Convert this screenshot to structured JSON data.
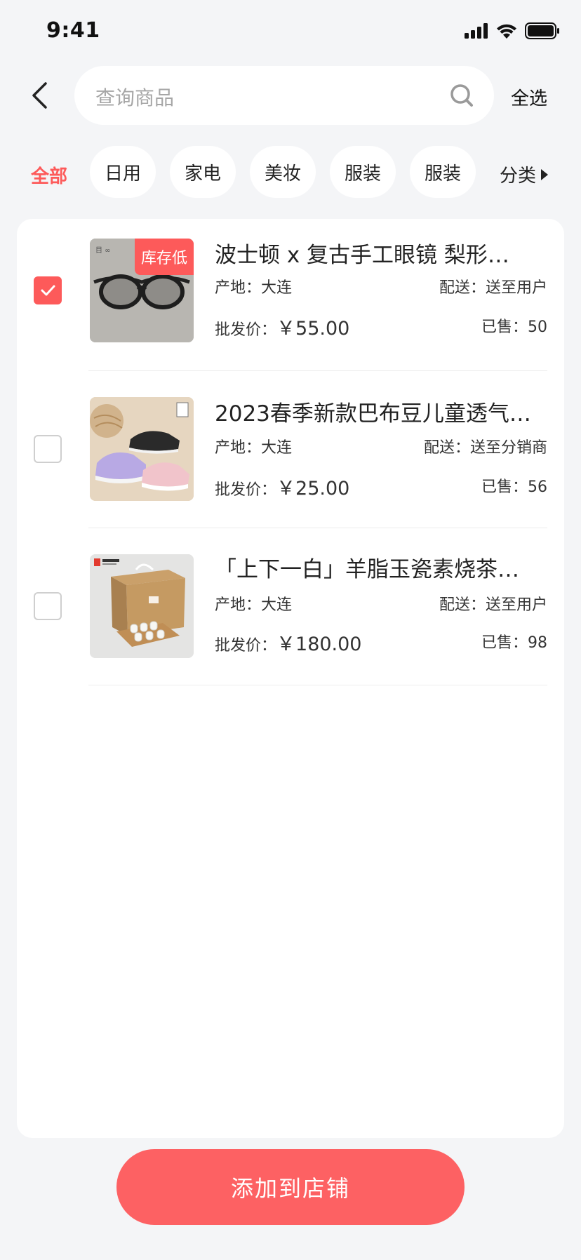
{
  "status_bar": {
    "time": "9:41"
  },
  "header": {
    "search_placeholder": "查询商品",
    "select_all": "全选"
  },
  "categories": {
    "active": "全部",
    "pills": [
      "日用",
      "家电",
      "美妆",
      "服装",
      "服装"
    ],
    "more": "分类"
  },
  "products": [
    {
      "checked": true,
      "badge": "库存低",
      "title": "波士顿 x 复古手工眼镜 梨形…",
      "origin": "产地：大连",
      "shipping": "配送：送至用户",
      "price_label": "批发价：",
      "price": "￥55.00",
      "sold": "已售：50",
      "image": "glasses"
    },
    {
      "checked": false,
      "badge": "",
      "title": "2023春季新款巴布豆儿童透气…",
      "origin": "产地：大连",
      "shipping": "配送：送至分销商",
      "price_label": "批发价：",
      "price": "￥25.00",
      "sold": "已售：56",
      "image": "sneakers"
    },
    {
      "checked": false,
      "badge": "",
      "title": "「上下一白」羊脂玉瓷素烧茶…",
      "origin": "产地：大连",
      "shipping": "配送：送至用户",
      "price_label": "批发价：",
      "price": "￥180.00",
      "sold": "已售：98",
      "image": "teaset"
    }
  ],
  "footer": {
    "add_button": "添加到店铺"
  },
  "colors": {
    "accent": "#fd5a5a",
    "background": "#f4f5f7"
  }
}
